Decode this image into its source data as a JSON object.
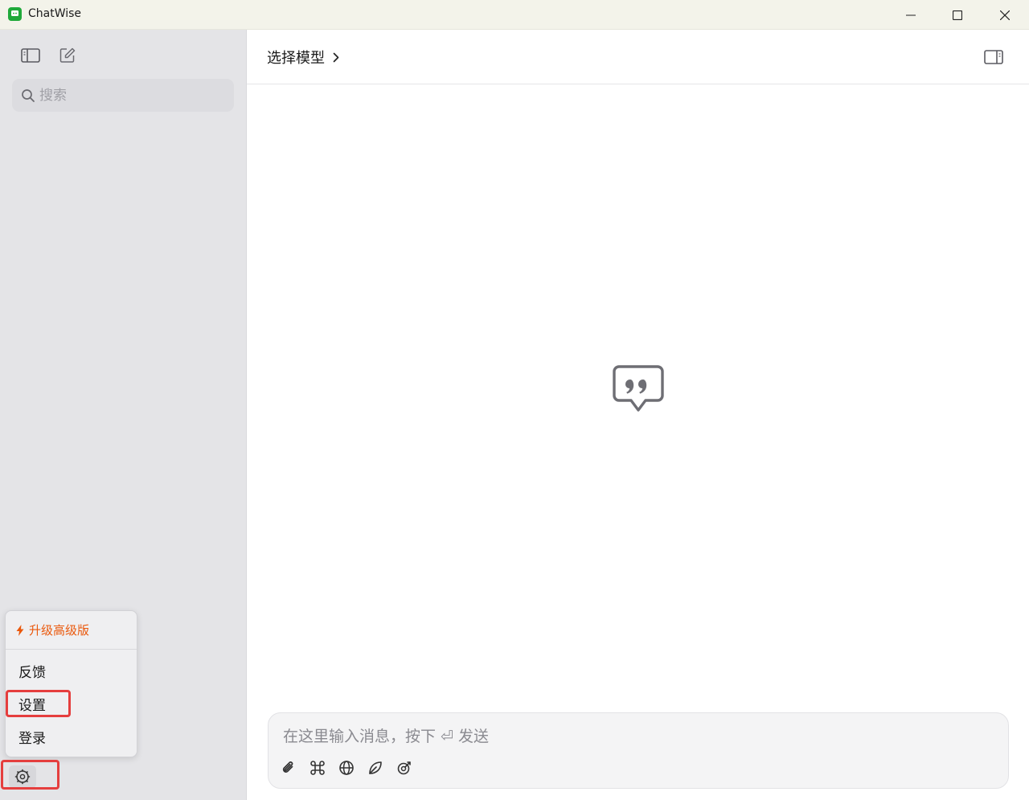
{
  "window": {
    "title": "ChatWise",
    "controls": {
      "minimize": "minimize-icon",
      "maximize": "maximize-icon",
      "close": "close-icon"
    }
  },
  "sidebar": {
    "search": {
      "placeholder": "搜索",
      "value": ""
    },
    "menu": {
      "upgrade_label": "升级高级版",
      "items": [
        {
          "label": "反馈"
        },
        {
          "label": "设置"
        },
        {
          "label": "登录"
        }
      ]
    }
  },
  "main": {
    "model_selector": {
      "label": "选择模型"
    },
    "composer": {
      "placeholder": "在这里输入消息，按下 ⏎ 发送",
      "value": "",
      "tools": [
        "attachment-icon",
        "command-icon",
        "globe-icon",
        "leaf-icon",
        "tools-icon"
      ]
    }
  },
  "colors": {
    "accent_upgrade": "#ea580c",
    "highlight": "#e53e3e",
    "sidebar_bg": "#e4e4e7",
    "logo": "#1fa93a"
  }
}
